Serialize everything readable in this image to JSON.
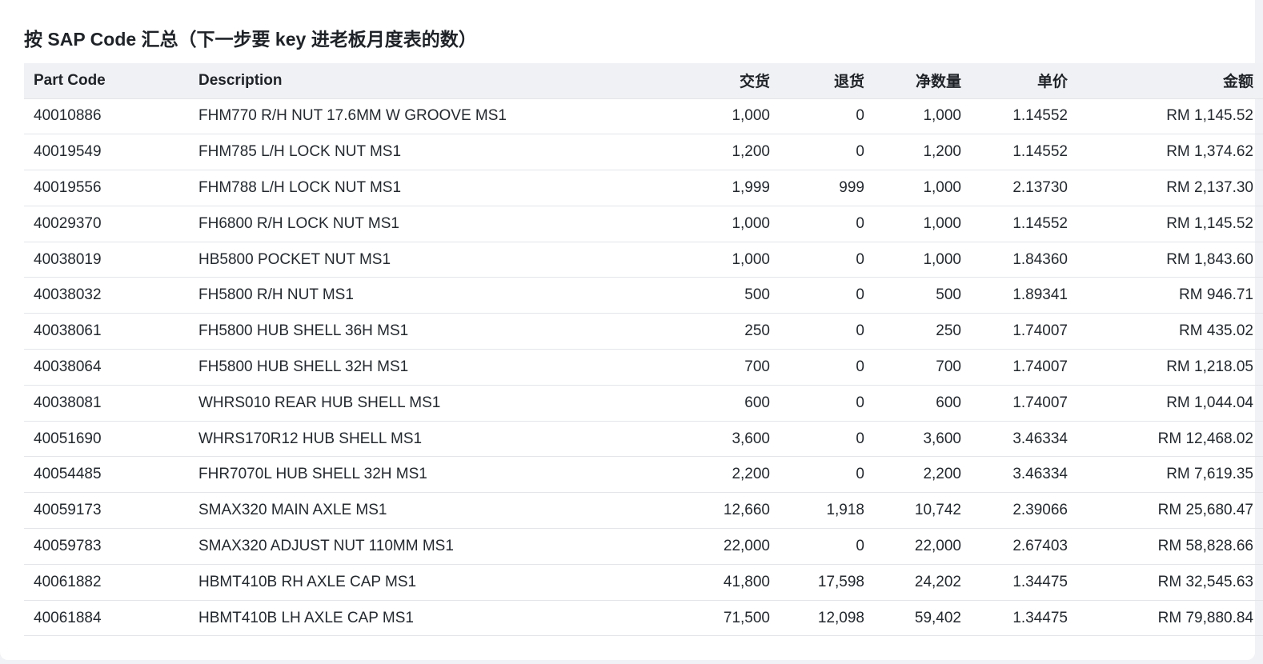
{
  "title": "按 SAP Code 汇总（下一步要 key 进老板月度表的数）",
  "columns": {
    "part_code": "Part Code",
    "description": "Description",
    "delivered": "交货",
    "returned": "退货",
    "net_qty": "净数量",
    "unit_price": "单价",
    "amount": "金额"
  },
  "rows": [
    {
      "code": "40010886",
      "desc": "FHM770 R/H NUT 17.6MM W GROOVE MS1",
      "delivered": "1,000",
      "returned": "0",
      "net": "1,000",
      "unit": "1.14552",
      "amount": "RM 1,145.52"
    },
    {
      "code": "40019549",
      "desc": "FHM785 L/H LOCK NUT MS1",
      "delivered": "1,200",
      "returned": "0",
      "net": "1,200",
      "unit": "1.14552",
      "amount": "RM 1,374.62"
    },
    {
      "code": "40019556",
      "desc": "FHM788 L/H LOCK NUT MS1",
      "delivered": "1,999",
      "returned": "999",
      "net": "1,000",
      "unit": "2.13730",
      "amount": "RM 2,137.30"
    },
    {
      "code": "40029370",
      "desc": "FH6800 R/H LOCK NUT MS1",
      "delivered": "1,000",
      "returned": "0",
      "net": "1,000",
      "unit": "1.14552",
      "amount": "RM 1,145.52"
    },
    {
      "code": "40038019",
      "desc": "HB5800 POCKET NUT MS1",
      "delivered": "1,000",
      "returned": "0",
      "net": "1,000",
      "unit": "1.84360",
      "amount": "RM 1,843.60"
    },
    {
      "code": "40038032",
      "desc": "FH5800 R/H NUT MS1",
      "delivered": "500",
      "returned": "0",
      "net": "500",
      "unit": "1.89341",
      "amount": "RM 946.71"
    },
    {
      "code": "40038061",
      "desc": "FH5800 HUB SHELL 36H MS1",
      "delivered": "250",
      "returned": "0",
      "net": "250",
      "unit": "1.74007",
      "amount": "RM 435.02"
    },
    {
      "code": "40038064",
      "desc": "FH5800 HUB SHELL 32H MS1",
      "delivered": "700",
      "returned": "0",
      "net": "700",
      "unit": "1.74007",
      "amount": "RM 1,218.05"
    },
    {
      "code": "40038081",
      "desc": "WHRS010 REAR HUB SHELL MS1",
      "delivered": "600",
      "returned": "0",
      "net": "600",
      "unit": "1.74007",
      "amount": "RM 1,044.04"
    },
    {
      "code": "40051690",
      "desc": "WHRS170R12 HUB SHELL MS1",
      "delivered": "3,600",
      "returned": "0",
      "net": "3,600",
      "unit": "3.46334",
      "amount": "RM 12,468.02"
    },
    {
      "code": "40054485",
      "desc": "FHR7070L HUB SHELL 32H MS1",
      "delivered": "2,200",
      "returned": "0",
      "net": "2,200",
      "unit": "3.46334",
      "amount": "RM 7,619.35"
    },
    {
      "code": "40059173",
      "desc": "SMAX320 MAIN AXLE MS1",
      "delivered": "12,660",
      "returned": "1,918",
      "net": "10,742",
      "unit": "2.39066",
      "amount": "RM 25,680.47"
    },
    {
      "code": "40059783",
      "desc": "SMAX320 ADJUST NUT 110MM MS1",
      "delivered": "22,000",
      "returned": "0",
      "net": "22,000",
      "unit": "2.67403",
      "amount": "RM 58,828.66"
    },
    {
      "code": "40061882",
      "desc": "HBMT410B RH AXLE CAP MS1",
      "delivered": "41,800",
      "returned": "17,598",
      "net": "24,202",
      "unit": "1.34475",
      "amount": "RM 32,545.63"
    },
    {
      "code": "40061884",
      "desc": "HBMT410B LH AXLE CAP MS1",
      "delivered": "71,500",
      "returned": "12,098",
      "net": "59,402",
      "unit": "1.34475",
      "amount": "RM 79,880.84"
    }
  ]
}
